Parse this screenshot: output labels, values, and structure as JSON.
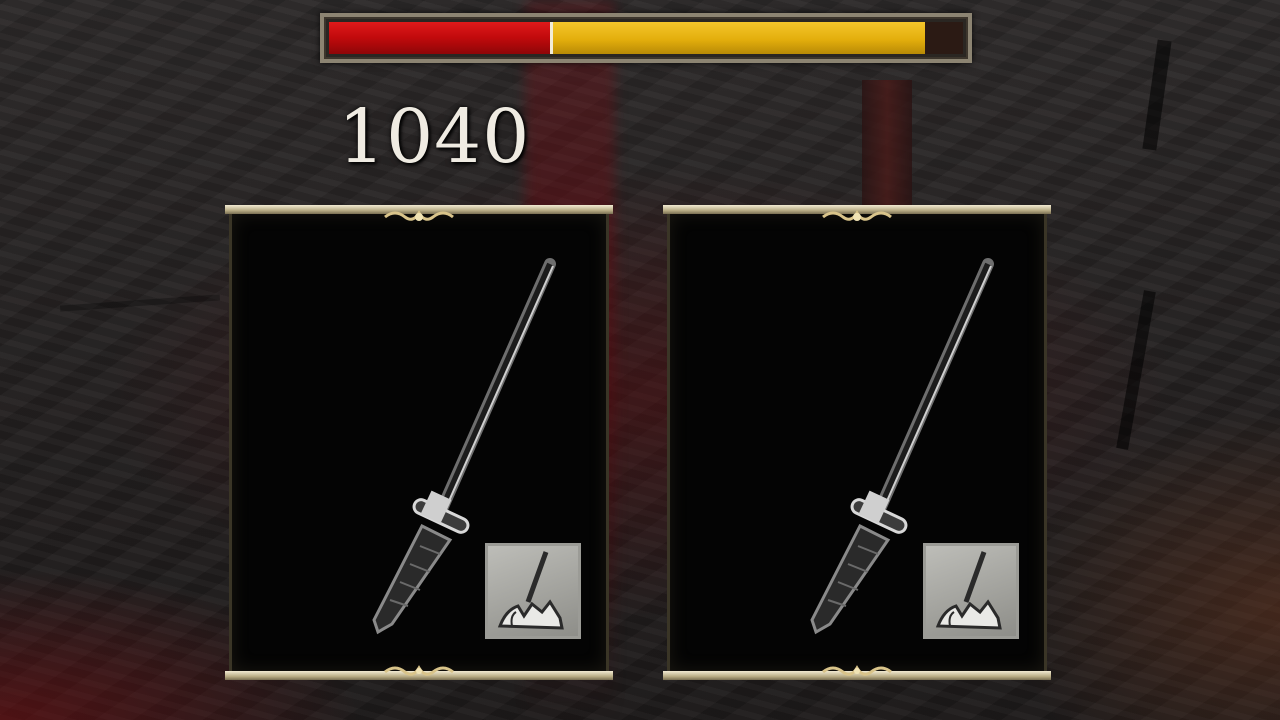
{
  "hud": {
    "health_bar": {
      "red_fraction": 0.35,
      "yellow_end_fraction": 0.94
    },
    "score": "1040"
  },
  "cards": [
    {
      "item_icon": "katana-icon",
      "action_icon": "hand-grab-icon"
    },
    {
      "item_icon": "katana-icon",
      "action_icon": "hand-grab-icon"
    }
  ],
  "colors": {
    "health_red": "#c00a0c",
    "health_yellow": "#e3ae0c",
    "frame_gold": "#b9ad86"
  }
}
